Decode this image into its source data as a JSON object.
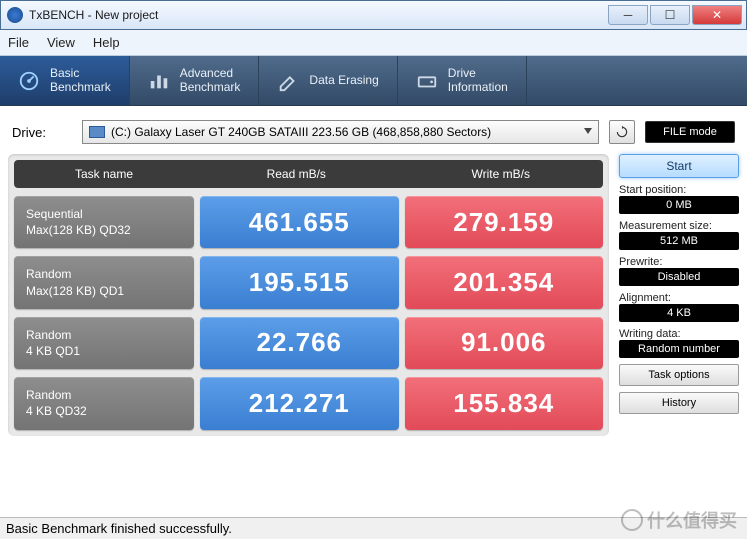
{
  "window": {
    "title": "TxBENCH - New project"
  },
  "menu": {
    "file": "File",
    "view": "View",
    "help": "Help"
  },
  "tabs": {
    "basic": {
      "line1": "Basic",
      "line2": "Benchmark"
    },
    "advanced": {
      "line1": "Advanced",
      "line2": "Benchmark"
    },
    "erase": {
      "line1": "Data Erasing"
    },
    "drive": {
      "line1": "Drive",
      "line2": "Information"
    }
  },
  "drive": {
    "label": "Drive:",
    "selected": "(C:) Galaxy Laser GT 240GB SATAIII  223.56 GB (468,858,880 Sectors)",
    "filemode": "FILE mode"
  },
  "headers": {
    "task": "Task name",
    "read": "Read mB/s",
    "write": "Write mB/s"
  },
  "rows": [
    {
      "name1": "Sequential",
      "name2": "Max(128 KB) QD32",
      "read": "461.655",
      "write": "279.159"
    },
    {
      "name1": "Random",
      "name2": "Max(128 KB) QD1",
      "read": "195.515",
      "write": "201.354"
    },
    {
      "name1": "Random",
      "name2": "4 KB QD1",
      "read": "22.766",
      "write": "91.006"
    },
    {
      "name1": "Random",
      "name2": "4 KB QD32",
      "read": "212.271",
      "write": "155.834"
    }
  ],
  "side": {
    "start": "Start",
    "startpos_label": "Start position:",
    "startpos_value": "0 MB",
    "meassize_label": "Measurement size:",
    "meassize_value": "512 MB",
    "prewrite_label": "Prewrite:",
    "prewrite_value": "Disabled",
    "align_label": "Alignment:",
    "align_value": "4 KB",
    "writedata_label": "Writing data:",
    "writedata_value": "Random number",
    "taskoptions": "Task options",
    "history": "History"
  },
  "status": "Basic Benchmark finished successfully.",
  "watermark": "什么值得买"
}
